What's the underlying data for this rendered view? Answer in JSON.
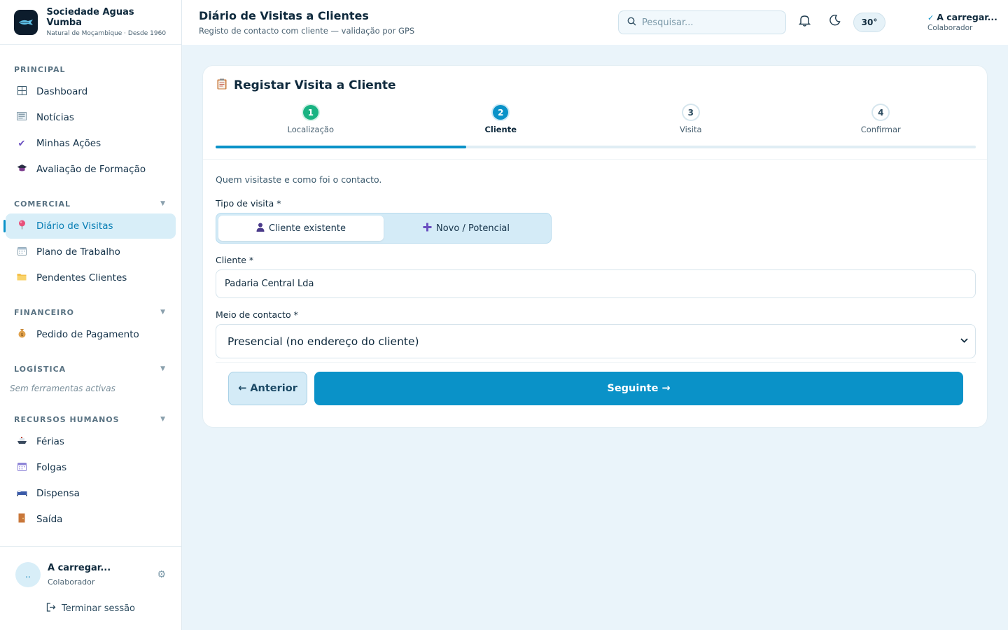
{
  "brand": {
    "name": "Sociedade Aguas Vumba",
    "tagline": "Natural de Moçambique · Desde 1960"
  },
  "sidebar": {
    "sections": [
      {
        "title": "PRINCIPAL",
        "items": [
          {
            "label": "Dashboard",
            "icon": "grid-icon"
          },
          {
            "label": "Notícias",
            "icon": "newspaper-icon"
          },
          {
            "label": "Minhas Ações",
            "icon": "check-icon"
          },
          {
            "label": "Avaliação de Formação",
            "icon": "graduation-cap-icon"
          }
        ]
      },
      {
        "title": "COMERCIAL",
        "items": [
          {
            "label": "Diário de Visitas",
            "icon": "pin-icon",
            "active": true
          },
          {
            "label": "Plano de Trabalho",
            "icon": "calendar-icon"
          },
          {
            "label": "Pendentes Clientes",
            "icon": "folder-icon"
          }
        ]
      },
      {
        "title": "FINANCEIRO",
        "items": [
          {
            "label": "Pedido de Pagamento",
            "icon": "money-bag-icon"
          }
        ]
      },
      {
        "title": "LOGÍSTICA",
        "empty": "Sem ferramentas activas"
      },
      {
        "title": "RECURSOS HUMANOS",
        "items": [
          {
            "label": "Férias",
            "icon": "boat-icon"
          },
          {
            "label": "Folgas",
            "icon": "calendar-icon"
          },
          {
            "label": "Dispensa",
            "icon": "bed-icon"
          },
          {
            "label": "Saída",
            "icon": "door-icon"
          }
        ]
      }
    ],
    "user": {
      "avatar": "..",
      "name": "A carregar...",
      "role": "Colaborador"
    },
    "logout": "Terminar sessão"
  },
  "header": {
    "title": "Diário de Visitas a Clientes",
    "subtitle": "Registo de contacto com cliente — validação por GPS",
    "search_placeholder": "Pesquisar...",
    "temperature": "30°",
    "user_name": "A carregar...",
    "user_role": "Colaborador"
  },
  "form": {
    "title": "Registar Visita a Cliente",
    "steps": [
      {
        "n": "1",
        "label": "Localização",
        "state": "done"
      },
      {
        "n": "2",
        "label": "Cliente",
        "state": "current"
      },
      {
        "n": "3",
        "label": "Visita",
        "state": "todo"
      },
      {
        "n": "4",
        "label": "Confirmar",
        "state": "todo"
      }
    ],
    "progress_fraction": 0.33,
    "intro": "Quem visitaste e como foi o contacto.",
    "visit_type_label": "Tipo de visita *",
    "visit_type_options": [
      "Cliente existente",
      "Novo / Potencial"
    ],
    "visit_type_selected": "Cliente existente",
    "client_label": "Cliente *",
    "client_value": "Padaria Central Lda",
    "contact_label": "Meio de contacto *",
    "contact_value": "Presencial (no endereço do cliente)",
    "prev_label": "← Anterior",
    "next_label": "Seguinte →"
  },
  "colors": {
    "accent": "#0a92c8",
    "done": "#19b382",
    "background": "#eaf4fa"
  }
}
